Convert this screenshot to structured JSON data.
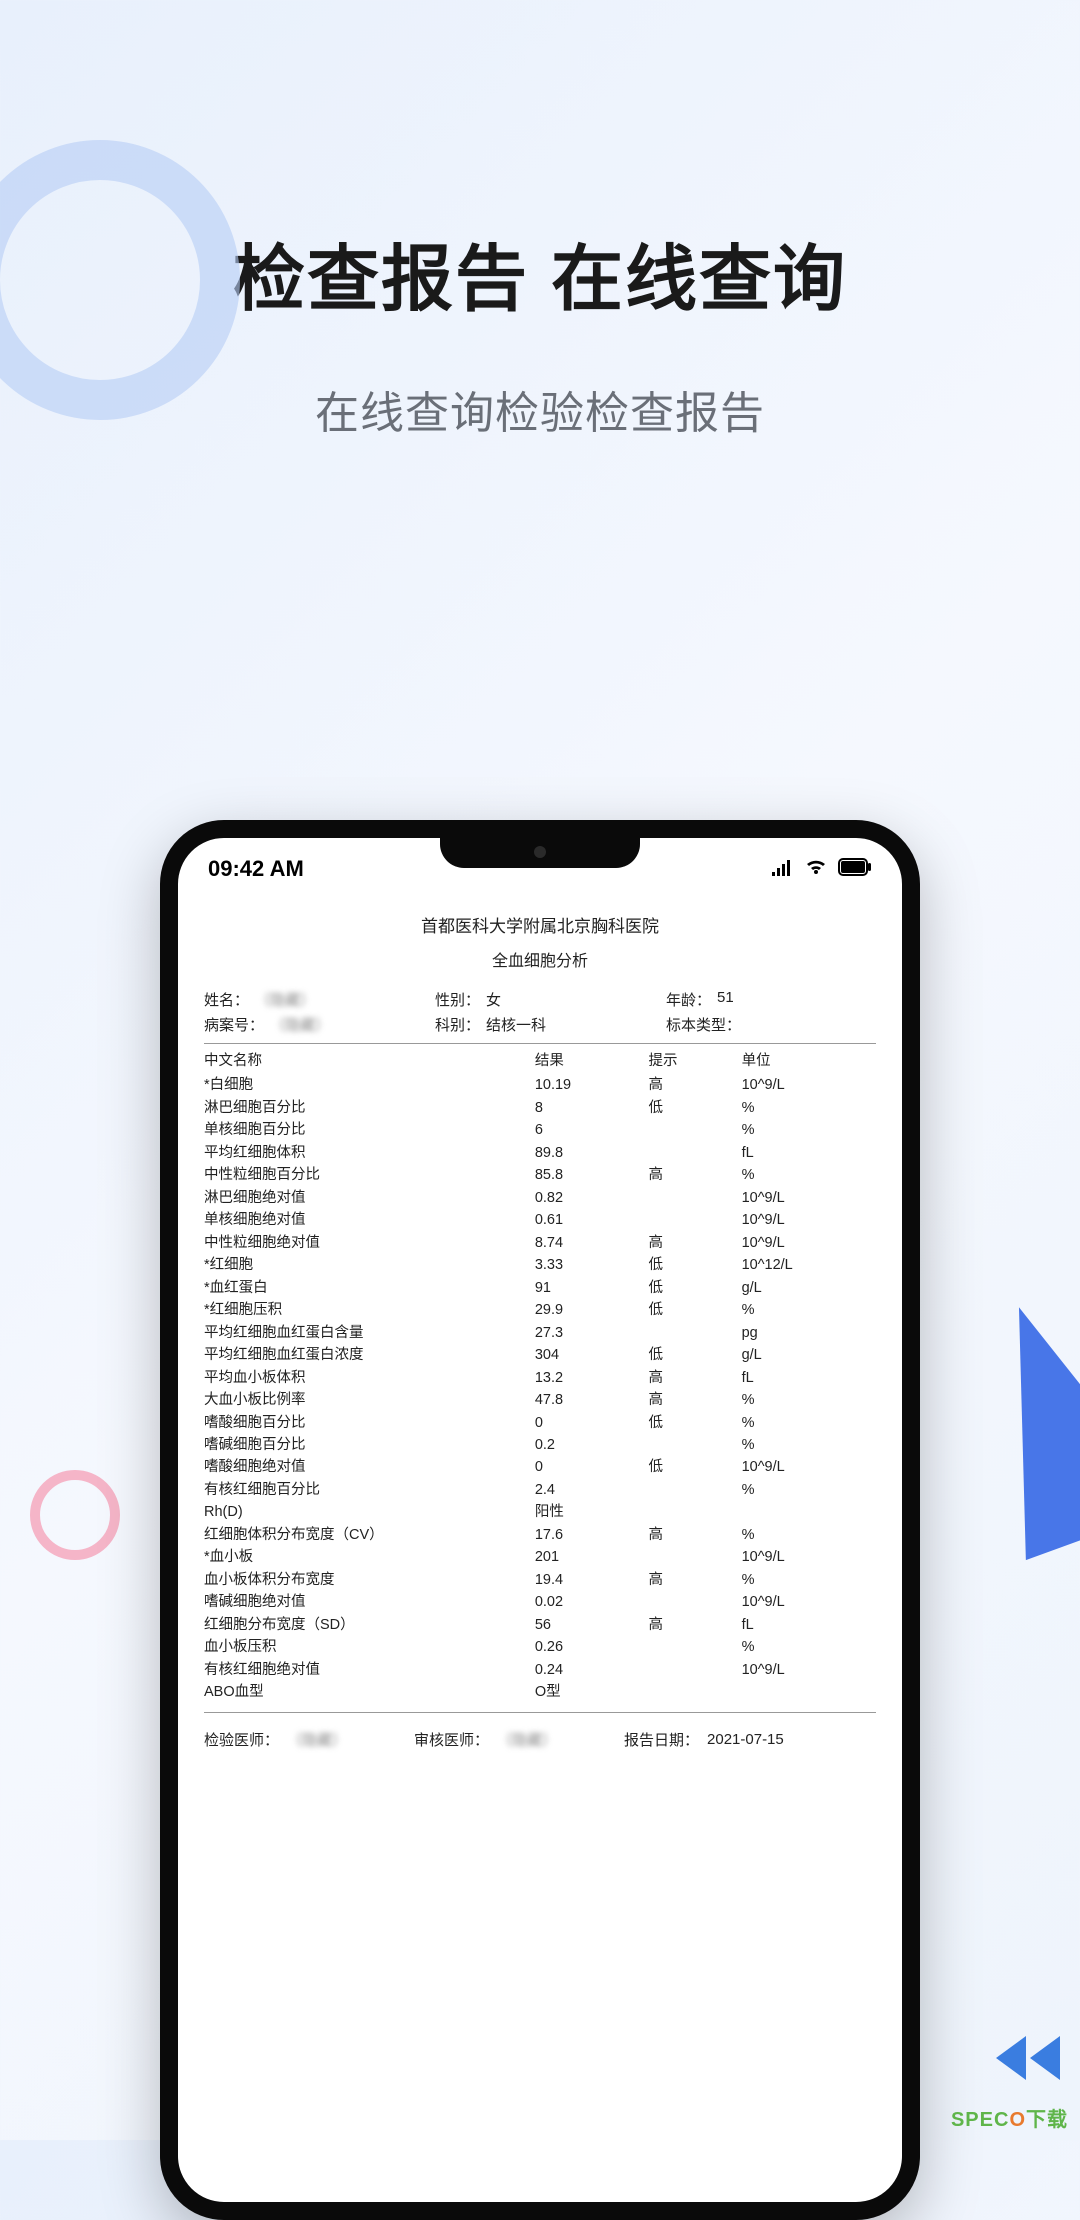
{
  "hero": {
    "title": "检查报告 在线查询",
    "subtitle": "在线查询检验检查报告"
  },
  "status_bar": {
    "time": "09:42 AM"
  },
  "report": {
    "hospital": "首都医科大学附属北京胸科医院",
    "type": "全血细胞分析",
    "patient_labels": {
      "name": "姓名：",
      "gender": "性别：",
      "age": "年龄：",
      "case_no": "病案号：",
      "dept": "科别：",
      "specimen": "标本类型："
    },
    "patient": {
      "name": "（隐藏）",
      "gender": "女",
      "age": "51",
      "case_no": "（隐藏）",
      "dept": "结核一科",
      "specimen": ""
    },
    "columns": {
      "name": "中文名称",
      "result": "结果",
      "flag": "提示",
      "unit": "单位"
    },
    "rows": [
      {
        "name": "*白细胞",
        "result": "10.19",
        "flag": "高",
        "unit": "10^9/L"
      },
      {
        "name": "淋巴细胞百分比",
        "result": "8",
        "flag": "低",
        "unit": "%"
      },
      {
        "name": "单核细胞百分比",
        "result": "6",
        "flag": "",
        "unit": "%"
      },
      {
        "name": "平均红细胞体积",
        "result": "89.8",
        "flag": "",
        "unit": "fL"
      },
      {
        "name": "中性粒细胞百分比",
        "result": "85.8",
        "flag": "高",
        "unit": "%"
      },
      {
        "name": "淋巴细胞绝对值",
        "result": "0.82",
        "flag": "",
        "unit": "10^9/L"
      },
      {
        "name": "单核细胞绝对值",
        "result": "0.61",
        "flag": "",
        "unit": "10^9/L"
      },
      {
        "name": "中性粒细胞绝对值",
        "result": "8.74",
        "flag": "高",
        "unit": "10^9/L"
      },
      {
        "name": "*红细胞",
        "result": "3.33",
        "flag": "低",
        "unit": "10^12/L"
      },
      {
        "name": "*血红蛋白",
        "result": "91",
        "flag": "低",
        "unit": "g/L"
      },
      {
        "name": "*红细胞压积",
        "result": "29.9",
        "flag": "低",
        "unit": "%"
      },
      {
        "name": "平均红细胞血红蛋白含量",
        "result": "27.3",
        "flag": "",
        "unit": "pg"
      },
      {
        "name": "平均红细胞血红蛋白浓度",
        "result": "304",
        "flag": "低",
        "unit": "g/L"
      },
      {
        "name": "平均血小板体积",
        "result": "13.2",
        "flag": "高",
        "unit": "fL"
      },
      {
        "name": "大血小板比例率",
        "result": "47.8",
        "flag": "高",
        "unit": "%"
      },
      {
        "name": "嗜酸细胞百分比",
        "result": "0",
        "flag": "低",
        "unit": "%"
      },
      {
        "name": "嗜碱细胞百分比",
        "result": "0.2",
        "flag": "",
        "unit": "%"
      },
      {
        "name": "嗜酸细胞绝对值",
        "result": "0",
        "flag": "低",
        "unit": "10^9/L"
      },
      {
        "name": "有核红细胞百分比",
        "result": "2.4",
        "flag": "",
        "unit": "%"
      },
      {
        "name": "Rh(D)",
        "result": "阳性",
        "flag": "",
        "unit": ""
      },
      {
        "name": "红细胞体积分布宽度（CV）",
        "result": "17.6",
        "flag": "高",
        "unit": "%"
      },
      {
        "name": "*血小板",
        "result": "201",
        "flag": "",
        "unit": "10^9/L"
      },
      {
        "name": "血小板体积分布宽度",
        "result": "19.4",
        "flag": "高",
        "unit": "%"
      },
      {
        "name": "嗜碱细胞绝对值",
        "result": "0.02",
        "flag": "",
        "unit": "10^9/L"
      },
      {
        "name": "红细胞分布宽度（SD）",
        "result": "56",
        "flag": "高",
        "unit": "fL"
      },
      {
        "name": "血小板压积",
        "result": "0.26",
        "flag": "",
        "unit": "%"
      },
      {
        "name": "有核红细胞绝对值",
        "result": "0.24",
        "flag": "",
        "unit": "10^9/L"
      },
      {
        "name": "ABO血型",
        "result": "O型",
        "flag": "",
        "unit": ""
      }
    ],
    "footer_labels": {
      "doctor": "检验医师：",
      "reviewer": "审核医师：",
      "date": "报告日期："
    },
    "footer": {
      "doctor": "（隐藏）",
      "reviewer": "（隐藏）",
      "date": "2021-07-15"
    }
  },
  "watermark": {
    "brand_prefix": "SPEC",
    "brand_accent": "O",
    "suffix": "下载"
  }
}
